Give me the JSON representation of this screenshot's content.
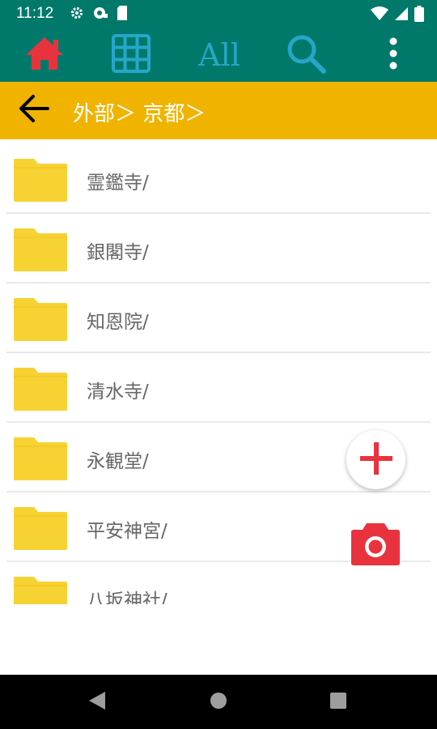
{
  "status_bar": {
    "time": "11:12",
    "icons": [
      "settings-icon",
      "notification-icon",
      "sd-card-icon",
      "wifi-icon",
      "signal-icon",
      "battery-icon"
    ]
  },
  "toolbar": {
    "home_icon": "home-icon",
    "grid_icon": "grid-icon",
    "all_label": "All",
    "search_icon": "search-icon",
    "more_icon": "more-vert-icon"
  },
  "path_bar": {
    "back_icon": "arrow-back-icon",
    "breadcrumb": "外部＞ 京都＞"
  },
  "folders": [
    {
      "name": "霊鑑寺/"
    },
    {
      "name": "銀閣寺/"
    },
    {
      "name": "知恩院/"
    },
    {
      "name": "清水寺/"
    },
    {
      "name": "永観堂/"
    },
    {
      "name": "平安神宮/"
    },
    {
      "name": "八坂神社/"
    }
  ],
  "fab": {
    "add_icon": "plus-icon",
    "camera_icon": "camera-icon"
  },
  "colors": {
    "toolbar": "#00796b",
    "path_bar": "#f0b400",
    "folder": "#f7d233",
    "accent_red": "#e8333e",
    "icon_blue": "#26a6c8"
  },
  "nav_bar": {
    "back_icon": "nav-back-icon",
    "home_icon": "nav-home-icon",
    "recent_icon": "nav-recent-icon"
  }
}
